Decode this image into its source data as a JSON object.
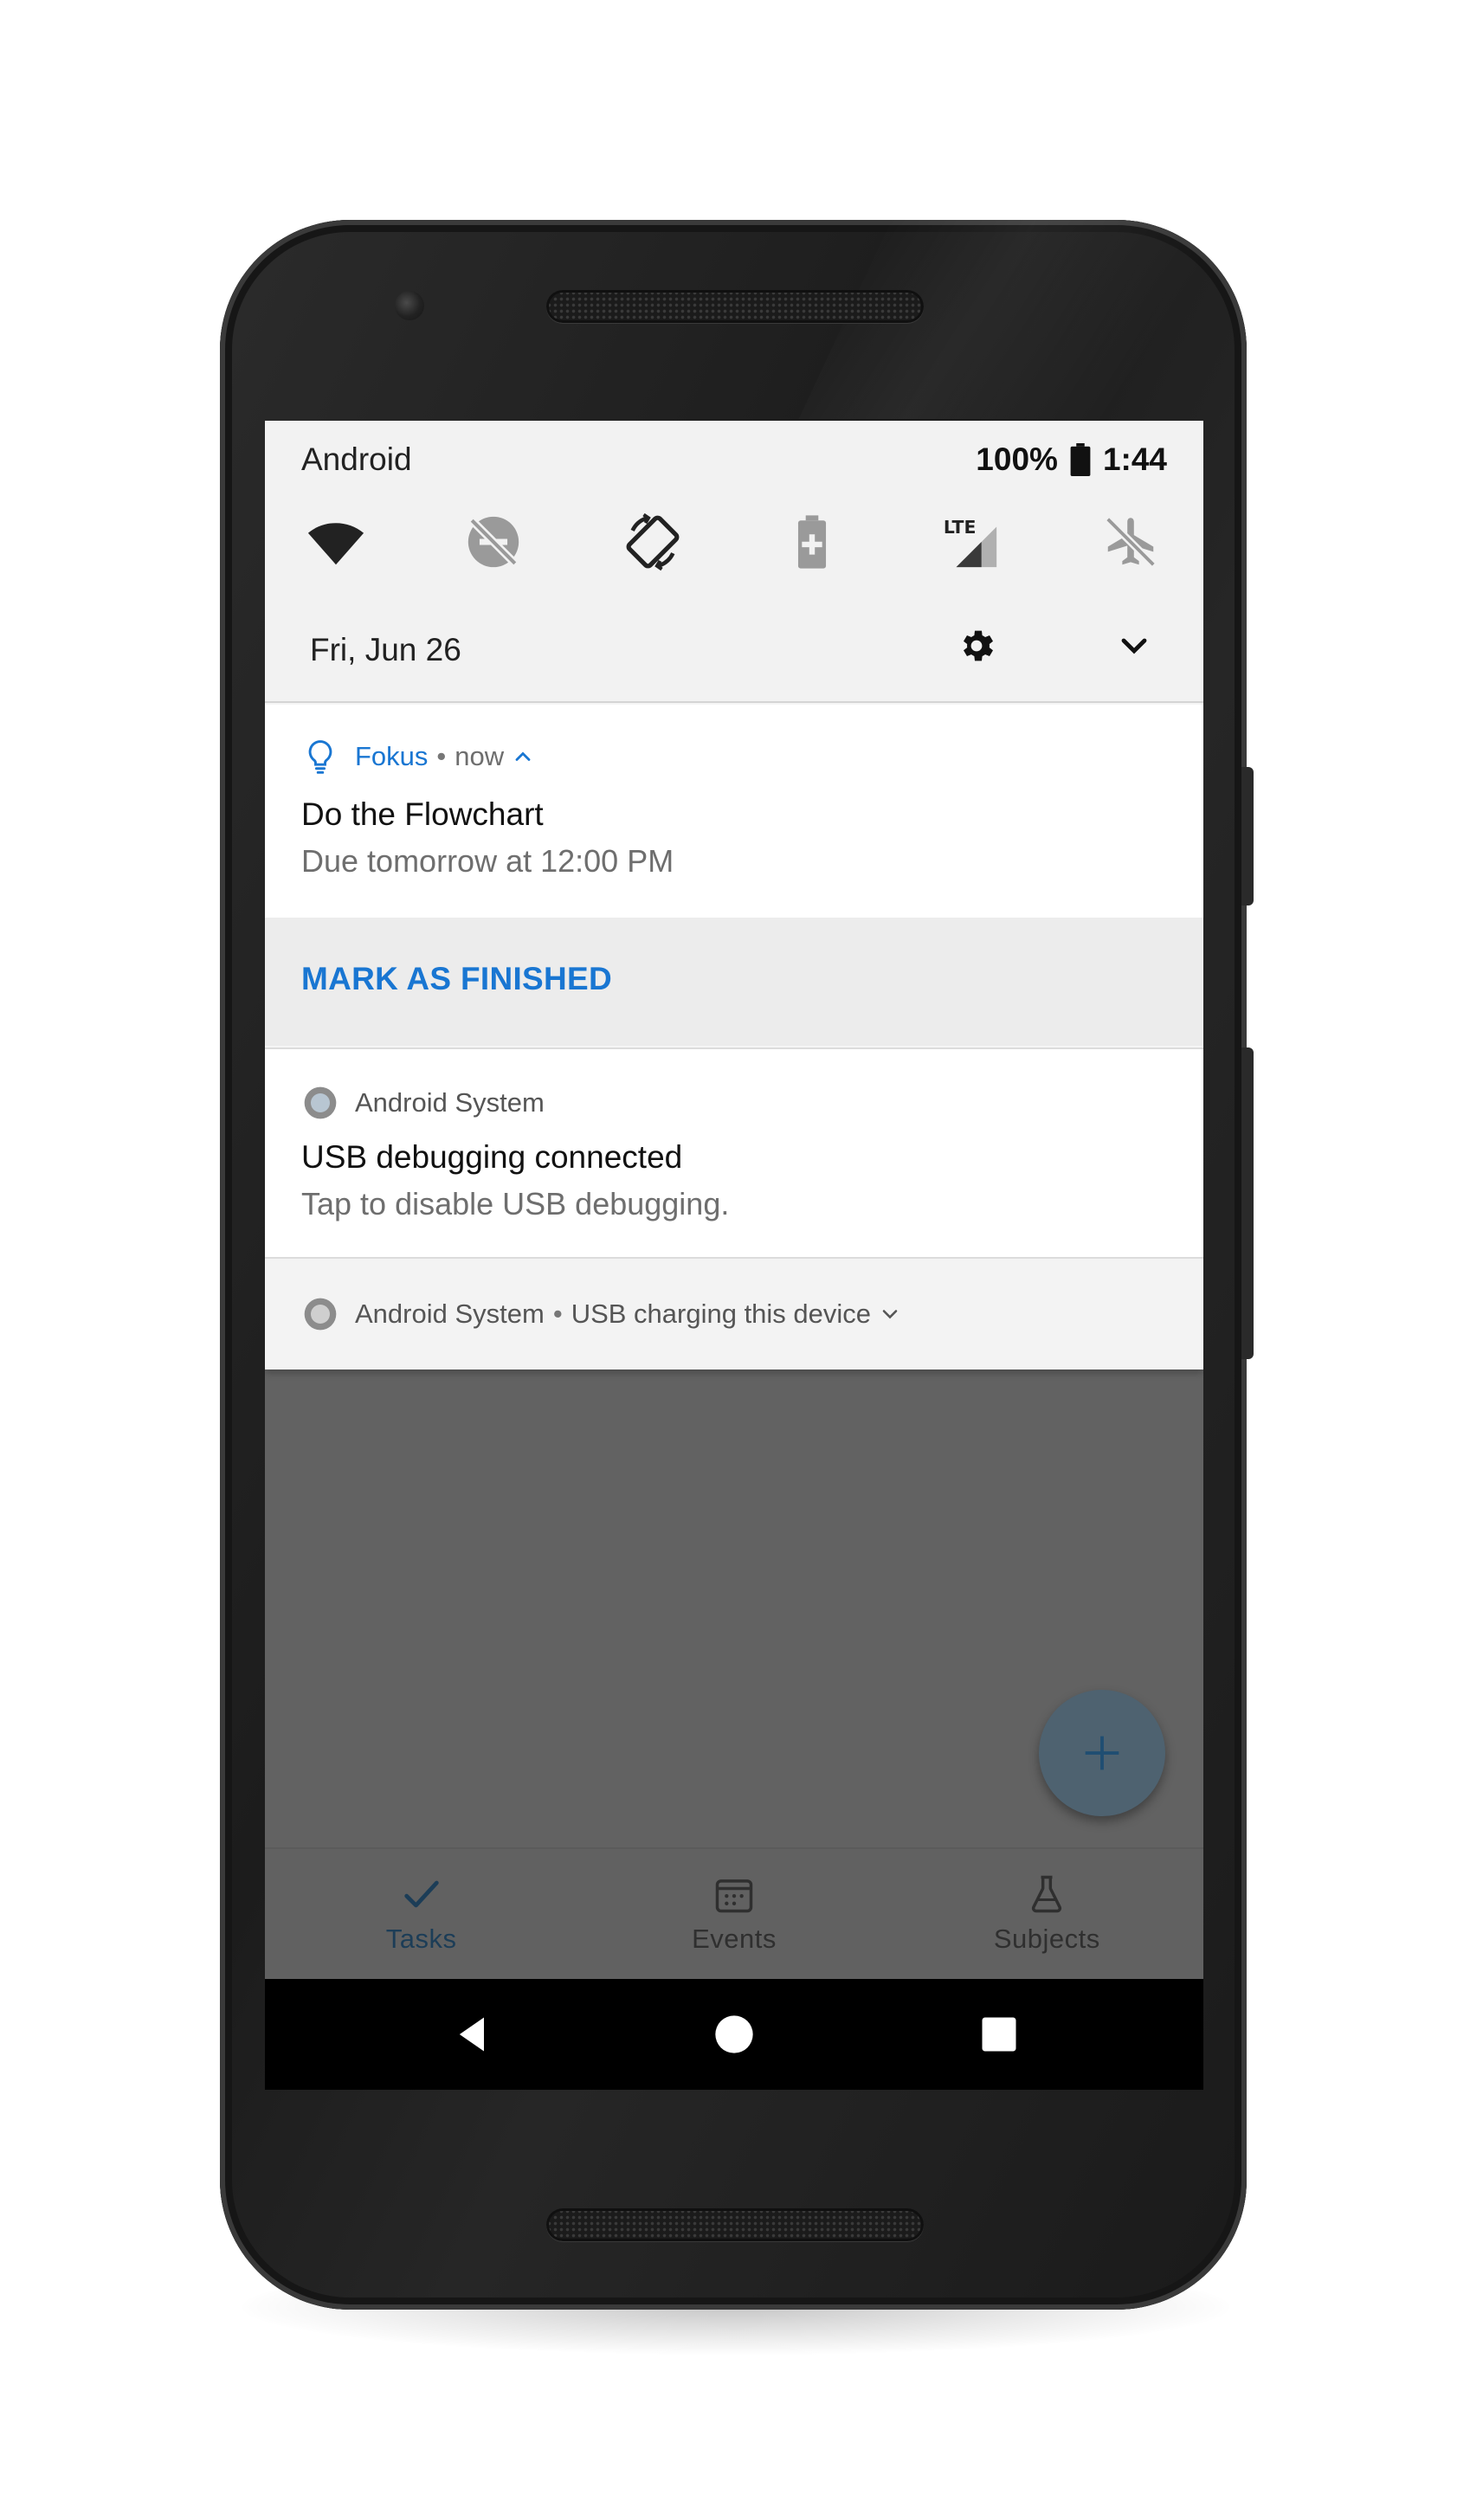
{
  "status_bar": {
    "carrier": "Android",
    "battery": "100%",
    "time": "1:44"
  },
  "quick_settings": {
    "tiles": [
      {
        "icon": "wifi-icon",
        "state": "on"
      },
      {
        "icon": "do-not-disturb-off-icon",
        "state": "off"
      },
      {
        "icon": "auto-rotate-icon",
        "state": "on"
      },
      {
        "icon": "battery-saver-icon",
        "state": "off"
      },
      {
        "icon": "lte-signal-icon",
        "state": "on"
      },
      {
        "icon": "airplane-mode-icon",
        "state": "off"
      }
    ],
    "date": "Fri, Jun 26"
  },
  "notifications": {
    "fokus": {
      "app_name": "Fokus",
      "separator": "•",
      "time": "now",
      "title": "Do the Flowchart",
      "text": "Due tomorrow at 12:00 PM",
      "action_label": "MARK AS FINISHED",
      "accent_color": "#1976d2"
    },
    "usb_debug": {
      "app_name": "Android System",
      "title": "USB debugging connected",
      "text": "Tap to disable USB debugging."
    },
    "usb_charge": {
      "app_name": "Android System",
      "separator": "•",
      "summary": "USB charging this device"
    }
  },
  "app": {
    "fab_icon": "plus-icon",
    "bottom_nav": [
      {
        "label": "Tasks",
        "icon": "check-icon",
        "active": true
      },
      {
        "label": "Events",
        "icon": "calendar-icon",
        "active": false
      },
      {
        "label": "Subjects",
        "icon": "flask-icon",
        "active": false
      }
    ]
  },
  "system_nav": {
    "back": "back-icon",
    "home": "home-icon",
    "recents": "recents-icon"
  }
}
